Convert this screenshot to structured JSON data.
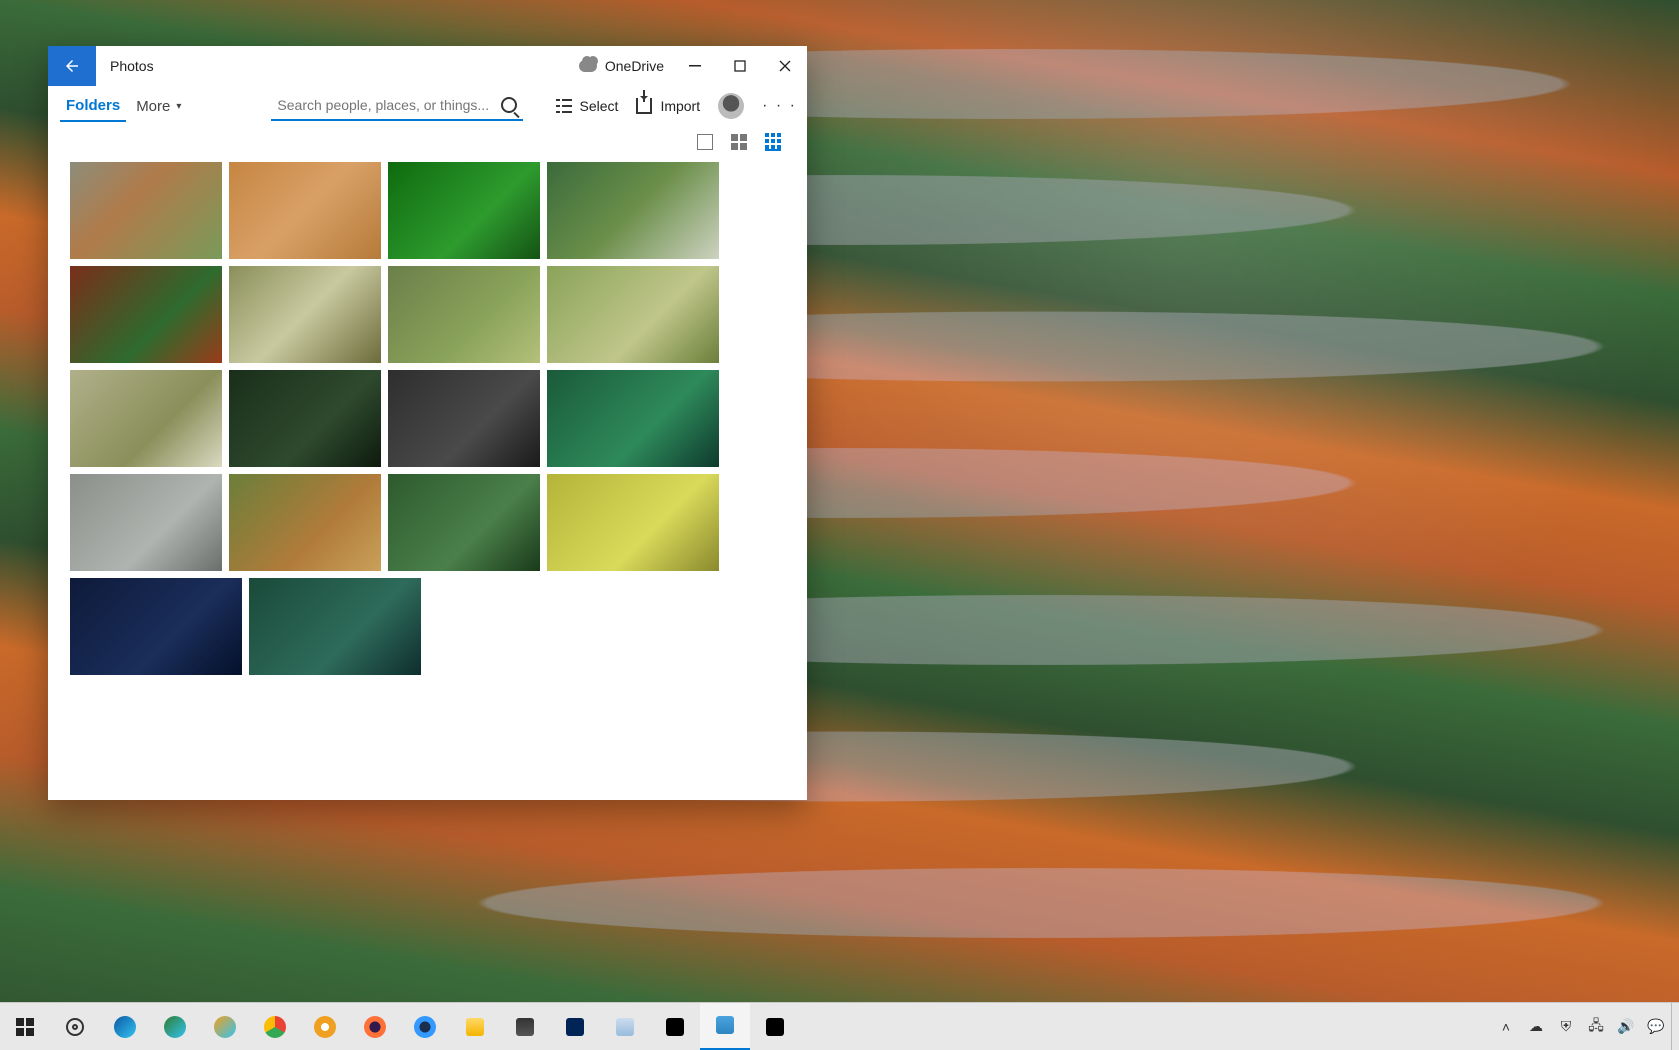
{
  "window": {
    "title": "Photos",
    "onedrive_label": "OneDrive",
    "tabs": {
      "folders": "Folders",
      "more": "More"
    },
    "search": {
      "placeholder": "Search people, places, or things..."
    },
    "toolbar": {
      "select": "Select",
      "import": "Import",
      "more_symbol": "· · ·"
    },
    "view": {
      "active": "grid-small"
    }
  },
  "thumbnails": [
    [
      {
        "name": "photo-01",
        "size": "narrow",
        "bg": "linear-gradient(135deg,#8d8d7a,#b07b4a 40%,#7a9a5a)"
      },
      {
        "name": "photo-02",
        "size": "narrow",
        "bg": "linear-gradient(135deg,#c68642,#d9a066 50%,#b57b3a)"
      },
      {
        "name": "photo-03",
        "size": "narrow",
        "bg": "linear-gradient(135deg,#0e6b0e,#2e9b2e 60%,#145214)"
      },
      {
        "name": "photo-04",
        "size": "wide",
        "bg": "linear-gradient(135deg,#3b6b3b,#6b8f4a 50%,#cdd2c0)"
      }
    ],
    [
      {
        "name": "photo-05",
        "size": "narrow",
        "bg": "linear-gradient(135deg,#7a2e1a,#2e6b2e 60%,#9a3b1a)"
      },
      {
        "name": "photo-06",
        "size": "narrow",
        "bg": "linear-gradient(135deg,#8a8f5a,#c9c9a0 50%,#6b6b3a)"
      },
      {
        "name": "photo-07",
        "size": "narrow",
        "bg": "linear-gradient(135deg,#6b7f4a,#8aa35a 60%,#b4c07a)"
      },
      {
        "name": "photo-08",
        "size": "wide",
        "bg": "linear-gradient(135deg,#8aa35a,#c0c68a 60%,#6b7f3a)"
      }
    ],
    [
      {
        "name": "photo-09",
        "size": "narrow",
        "bg": "linear-gradient(135deg,#b0b08a,#8a8f5a 60%,#d9d9c0)"
      },
      {
        "name": "photo-10",
        "size": "narrow",
        "bg": "linear-gradient(135deg,#1a2e1a,#2e4a2e 60%,#0e1a0e)"
      },
      {
        "name": "photo-11",
        "size": "narrow",
        "bg": "linear-gradient(135deg,#2e2e2e,#4a4a4a 60%,#1a1a1a)"
      },
      {
        "name": "photo-12",
        "size": "wide",
        "bg": "linear-gradient(135deg,#1a5a3a,#2e8a5a 60%,#0e3a2e)"
      }
    ],
    [
      {
        "name": "photo-13",
        "size": "narrow",
        "bg": "linear-gradient(135deg,#8a8f8a,#b0b4b0 60%,#6b6f6b)"
      },
      {
        "name": "photo-14",
        "size": "narrow",
        "bg": "linear-gradient(135deg,#6b7f3a,#b07b3a 60%,#c9a05a)"
      },
      {
        "name": "photo-15",
        "size": "narrow",
        "bg": "linear-gradient(135deg,#2e5a2e,#4a7f4a 60%,#1a3a1a)"
      },
      {
        "name": "photo-16",
        "size": "wide",
        "bg": "linear-gradient(135deg,#b4b43a,#d9d95a 60%,#8a8a2e)"
      }
    ],
    [
      {
        "name": "photo-17",
        "size": "wide",
        "bg": "linear-gradient(135deg,#0e1a3a,#1a2e5a 60%,#05102a)"
      },
      {
        "name": "photo-18",
        "size": "wide",
        "bg": "linear-gradient(135deg,#1a4a3a,#2e6b5a 60%,#0e2e2e)"
      }
    ]
  ],
  "taskbar": {
    "apps": [
      {
        "name": "start",
        "type": "winlogo"
      },
      {
        "name": "settings",
        "type": "gear"
      },
      {
        "name": "edge",
        "type": "circ",
        "bg": "linear-gradient(135deg,#0c59a4,#33c3f0)"
      },
      {
        "name": "edge-dev",
        "type": "circ",
        "bg": "linear-gradient(135deg,#2e7d32,#33c3f0)"
      },
      {
        "name": "edge-canary",
        "type": "circ",
        "bg": "linear-gradient(135deg,#f0a020,#33c3f0)"
      },
      {
        "name": "chrome",
        "type": "circ",
        "bg": "conic-gradient(#ea4335 0 120deg,#34a853 120deg 240deg,#fbbc05 240deg 360deg)"
      },
      {
        "name": "chrome-canary",
        "type": "circ",
        "bg": "radial-gradient(circle,#fff 0 25%,#f0a020 26% 100%)"
      },
      {
        "name": "firefox",
        "type": "circ",
        "bg": "radial-gradient(circle,#331a4d 0 35%,#ff7139 36% 100%)"
      },
      {
        "name": "firefox-dev",
        "type": "circ",
        "bg": "radial-gradient(circle,#1a2e4d 0 35%,#3399ff 36% 100%)"
      },
      {
        "name": "file-explorer",
        "type": "sq",
        "bg": "linear-gradient(#ffd966,#f4b400)"
      },
      {
        "name": "microsoft-store",
        "type": "sq",
        "bg": "linear-gradient(#333,#555)"
      },
      {
        "name": "powershell",
        "type": "sq",
        "bg": "#012456"
      },
      {
        "name": "notepad",
        "type": "sq",
        "bg": "linear-gradient(#cde,#9bd)"
      },
      {
        "name": "cmd",
        "type": "sq",
        "bg": "#000"
      },
      {
        "name": "photos",
        "type": "sq",
        "bg": "linear-gradient(#4aa3df,#2e86c1)",
        "active": true
      },
      {
        "name": "terminal",
        "type": "sq",
        "bg": "#000"
      }
    ],
    "tray": [
      {
        "name": "tray-overflow",
        "glyph": "˄"
      },
      {
        "name": "onedrive-tray",
        "glyph": "☁"
      },
      {
        "name": "security",
        "glyph": "⛨"
      },
      {
        "name": "network",
        "glyph": "🖧"
      },
      {
        "name": "volume",
        "glyph": "🔊"
      },
      {
        "name": "notifications",
        "glyph": "💬"
      }
    ]
  }
}
